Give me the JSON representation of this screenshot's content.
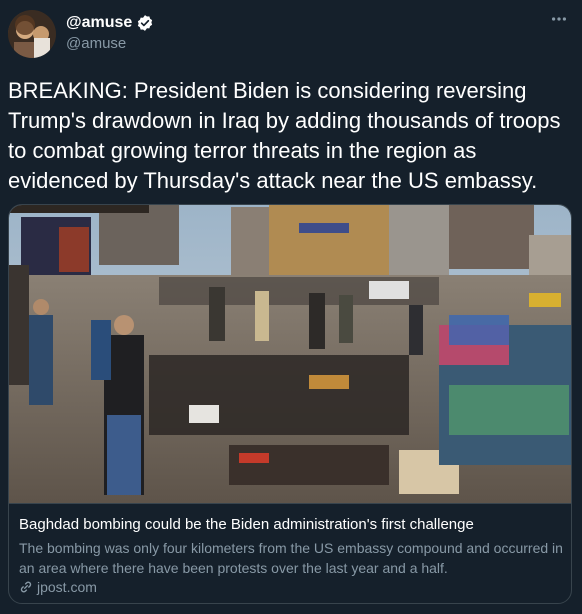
{
  "user": {
    "display_name": "@amuse",
    "handle": "@amuse",
    "verified": true
  },
  "tweet": {
    "text": "BREAKING: President Biden is considering reversing Trump's drawdown in Iraq by adding thousands of troops to combat growing terror threats in the region as evidenced by Thursday's attack near the US embassy."
  },
  "card": {
    "title": "Baghdad bombing could be the Biden administration's first challenge",
    "description": "The bombing was only four kilometers from the US embassy compound and occurred in an area where there have been protests over the last year and a half.",
    "domain": "jpost.com"
  },
  "icons": {
    "verified": "verified-badge-icon",
    "more": "more-options-icon",
    "link": "link-icon"
  },
  "colors": {
    "background": "#15202b",
    "secondary_text": "#8899a6",
    "border": "#38444d",
    "verified": "#ffffff"
  }
}
